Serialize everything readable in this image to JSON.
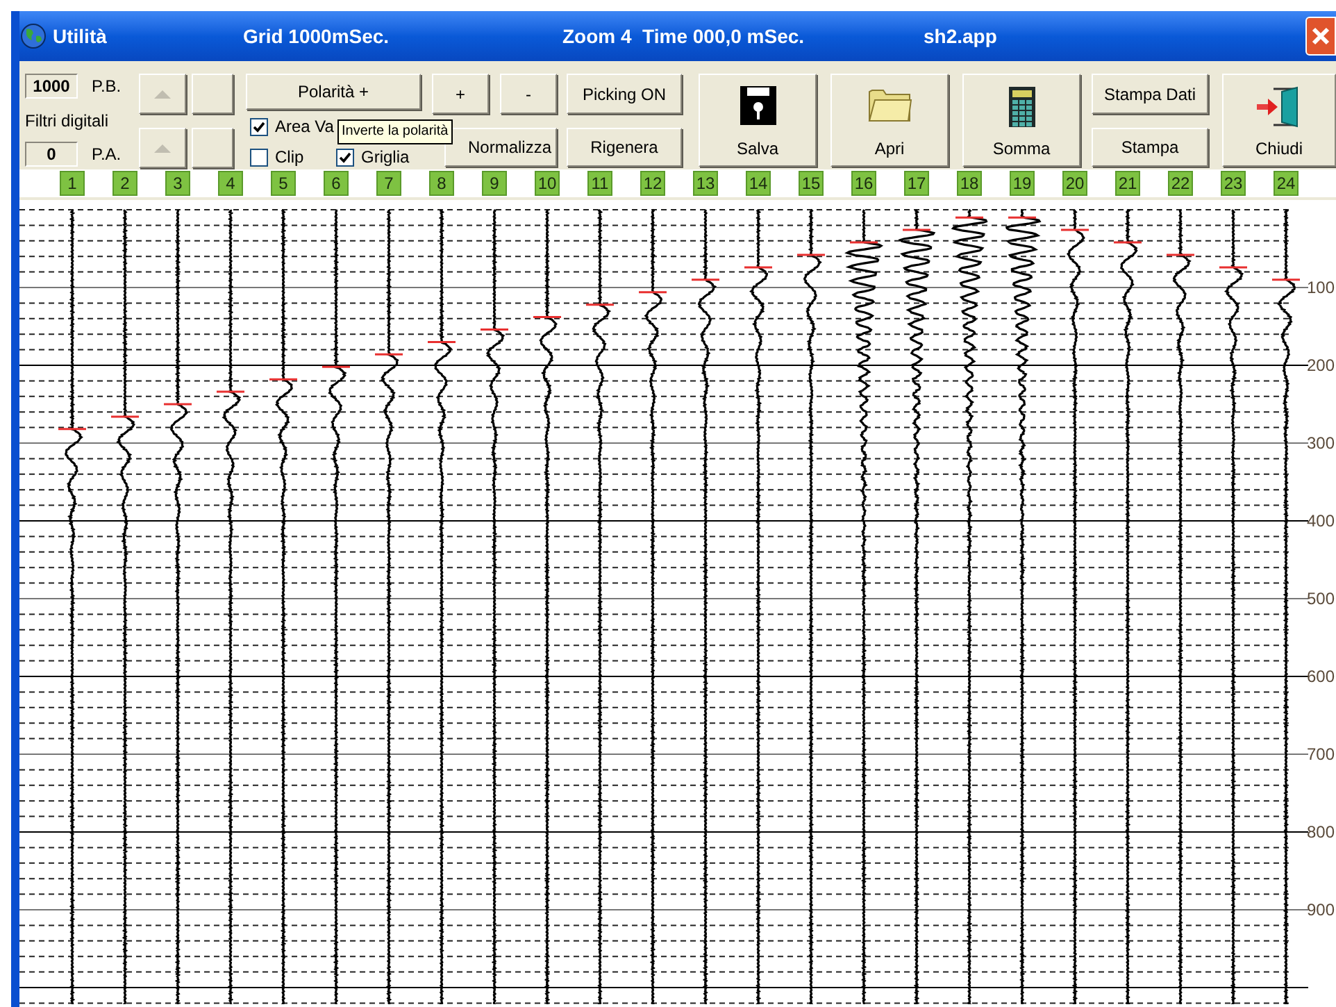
{
  "window": {
    "title": "Utilità",
    "grid": "Grid 1000mSec.",
    "zoom": "Zoom 4  Time 000,0 mSec.",
    "file": "sh2.app"
  },
  "filters": {
    "high_cut": {
      "value": "1000",
      "label": "P.B."
    },
    "caption": "Filtri digitali",
    "low_cut": {
      "value": "0",
      "label": "P.A."
    }
  },
  "spin_buttons": [
    {
      "disabled": true
    },
    {
      "disabled": true
    }
  ],
  "polarity_button": "Polarità +",
  "checkboxes": [
    {
      "label": "Area Va",
      "checked": true
    },
    {
      "label": "Clip",
      "checked": false
    },
    {
      "label": "Griglia",
      "checked": true
    }
  ],
  "tooltip": "Inverte la polarità",
  "gain_buttons": [
    "+",
    "-"
  ],
  "normalize_button": "Normalizza",
  "picking_button": "Picking ON",
  "regenerate_button": "Rigenera",
  "big_buttons": [
    {
      "kind": "save",
      "label": "Salva"
    },
    {
      "kind": "open",
      "label": "Apri"
    },
    {
      "kind": "sum",
      "label": "Somma"
    }
  ],
  "print_buttons": [
    "Stampa Dati",
    "Stampa"
  ],
  "close_button": {
    "kind": "exit",
    "label": "Chiudi"
  },
  "traces": [
    "1",
    "2",
    "3",
    "4",
    "5",
    "6",
    "7",
    "8",
    "9",
    "10",
    "11",
    "12",
    "13",
    "14",
    "15",
    "16",
    "17",
    "18",
    "19",
    "20",
    "21",
    "22",
    "23",
    "24"
  ],
  "time_axis": [
    "100",
    "200",
    "300",
    "400",
    "500",
    "600",
    "700",
    "800",
    "900"
  ]
}
